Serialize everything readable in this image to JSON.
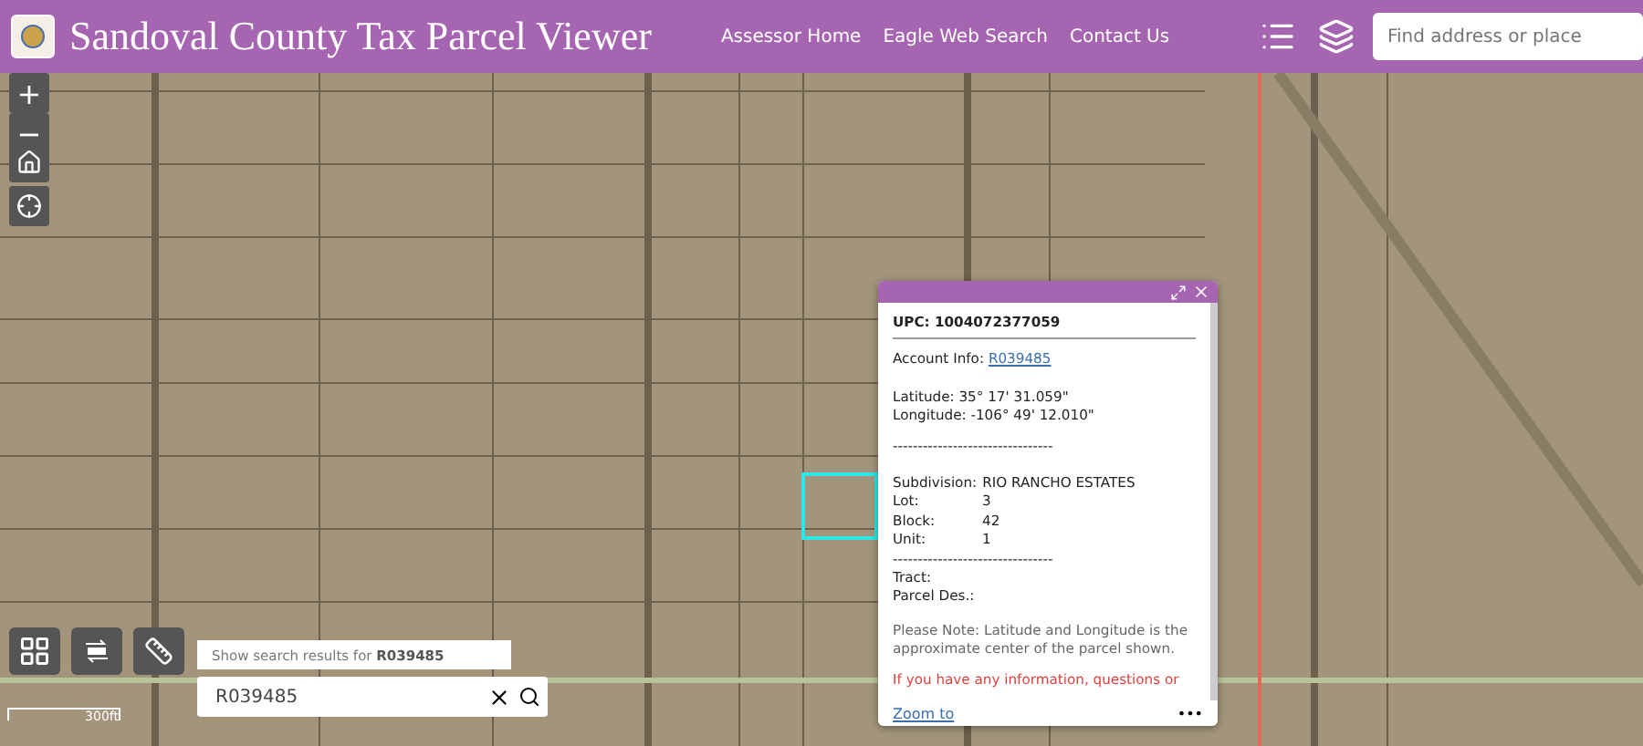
{
  "header": {
    "title": "Sandoval County Tax Parcel Viewer",
    "links": [
      "Assessor Home",
      "Eagle Web Search",
      "Contact Us"
    ],
    "search": {
      "placeholder": "Find address or place"
    }
  },
  "map_controls": {
    "zoom_in": "+",
    "zoom_out": "−"
  },
  "popup": {
    "title": "UPC: 1004072377059",
    "account_label": "Account Info:",
    "account_link": "R039485",
    "latitude": "Latitude: 35° 17' 31.059\"",
    "longitude": "Longitude: -106° 49' 12.010\"",
    "divider": "--------------------------------",
    "fields": [
      {
        "label": "Subdivision:",
        "value": "RIO RANCHO ESTATES",
        "kind": "inline"
      },
      {
        "label": "Lot:",
        "value": "3",
        "kind": "column"
      },
      {
        "label": "Block:",
        "value": "42",
        "kind": "column"
      },
      {
        "label": "Unit:",
        "value": "1",
        "kind": "column"
      }
    ],
    "divider_2": "--------------------------------",
    "tract": "Tract:",
    "parcel_des": "Parcel Des.:",
    "note": "Please Note: Latitude and Longitude is the approximate center of the parcel shown.",
    "warning": "If you have any information, questions or",
    "zoom_link": "Zoom to",
    "more": "•••"
  },
  "search": {
    "suggestion_prefix": "Show search results for",
    "suggestion_term": "R039485",
    "value": "R039485"
  },
  "scale": "300ft"
}
